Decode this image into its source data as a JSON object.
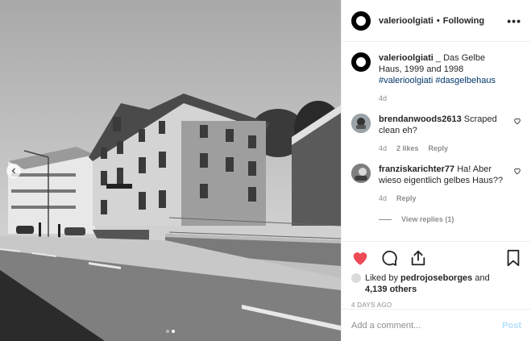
{
  "header": {
    "username": "valerioolgiati",
    "separator": "•",
    "follow_state": "Following",
    "more_label": "•••"
  },
  "caption": {
    "username": "valerioolgiati",
    "text": " _ Das Gelbe Haus, 1999 and 1998",
    "hashtag1": "#valerioolgiati",
    "hashtag2": "#dasgelbehaus",
    "time": "4d"
  },
  "comments": [
    {
      "username": "brendanwoods2613",
      "text": " Scraped clean eh?",
      "time": "4d",
      "likes": "2 likes",
      "reply": "Reply"
    },
    {
      "username": "franziskarichter77",
      "text": " Ha! Aber wieso eigentlich gelbes Haus??",
      "time": "4d",
      "reply": "Reply",
      "view_replies": "View replies (1)"
    }
  ],
  "likes": {
    "prefix": "Liked by ",
    "user": "pedrojoseborges",
    "middle": " and",
    "others": "4,139 others"
  },
  "date": "4 DAYS AGO",
  "add_comment": {
    "placeholder": "Add a comment...",
    "post_label": "Post"
  },
  "carousel": {
    "slides": 2,
    "active_index": 1
  },
  "colors": {
    "like": "#ed4956",
    "link": "#003569",
    "muted": "#8e8e8e",
    "post_disabled": "#b2dffc"
  },
  "icons": [
    "heart-icon",
    "comment-icon",
    "share-icon",
    "bookmark-icon",
    "chevron-left-icon",
    "small-heart-icon",
    "more-icon"
  ]
}
